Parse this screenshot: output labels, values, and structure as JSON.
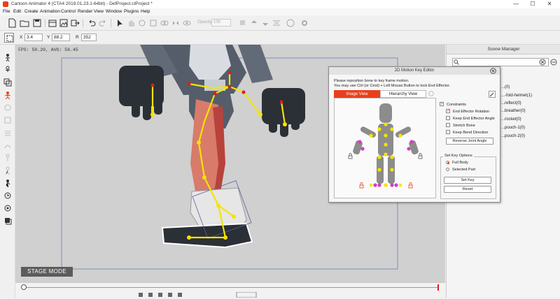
{
  "window": {
    "title": "Cartoon Animator 4  (CTA4 2019.01.23.1-64bit) - DefProject.ctProject *",
    "minimize": "—",
    "maximize": "☐",
    "close": "✕"
  },
  "menu": [
    "File",
    "Edit",
    "Create",
    "Animation",
    "Control",
    "Render",
    "View",
    "Window",
    "Plugins",
    "Help"
  ],
  "toolbar": {
    "opacity_label": "Opacity",
    "opacity_value": "100"
  },
  "transform": {
    "x_label": "X",
    "x_value": "3.4",
    "y_label": "Y",
    "y_value": "88.2",
    "r_label": "R",
    "r_value": "352"
  },
  "stage": {
    "fps_text": "FPS: 50.20, AVG: 56.45",
    "mode_label": "STAGE MODE"
  },
  "scene_manager": {
    "title": "Scene Manager",
    "items": [
      "...(0)",
      "...-fold-helmet(1)",
      "...reflect(0)",
      "...breather(0)",
      "...rocket(0)",
      "...pouch-1(0)",
      "...pouch-2(0)"
    ]
  },
  "dialog": {
    "title": "2D Motion Key Editor",
    "instruction1": "Please reposition bone to key frame motion.",
    "instruction2": "You may use Ctrl (or Cmd) + Left Mouse Button to lock End Effector.",
    "tab_image": "Image View",
    "tab_hierarchy": "Hierarchy View",
    "constraints_label": "Constraints",
    "options": [
      {
        "label": "End Effector Rotation",
        "checked": true
      },
      {
        "label": "Keep End Effector Angle",
        "checked": false
      },
      {
        "label": "Stretch Bone",
        "checked": false
      },
      {
        "label": "Keep Bend Direction",
        "checked": false
      }
    ],
    "reverse_button": "Reverse Joint Angle",
    "set_key_options": "Set Key Options",
    "full_body": "Full Body",
    "selected_part": "Selected Part",
    "set_key_button": "Set Key",
    "reset_button": "Reset"
  },
  "colors": {
    "accent": "#e8401c",
    "joint_yellow": "#f5e400",
    "joint_magenta": "#d23fbf",
    "bone_gray": "#8c8c8c"
  }
}
